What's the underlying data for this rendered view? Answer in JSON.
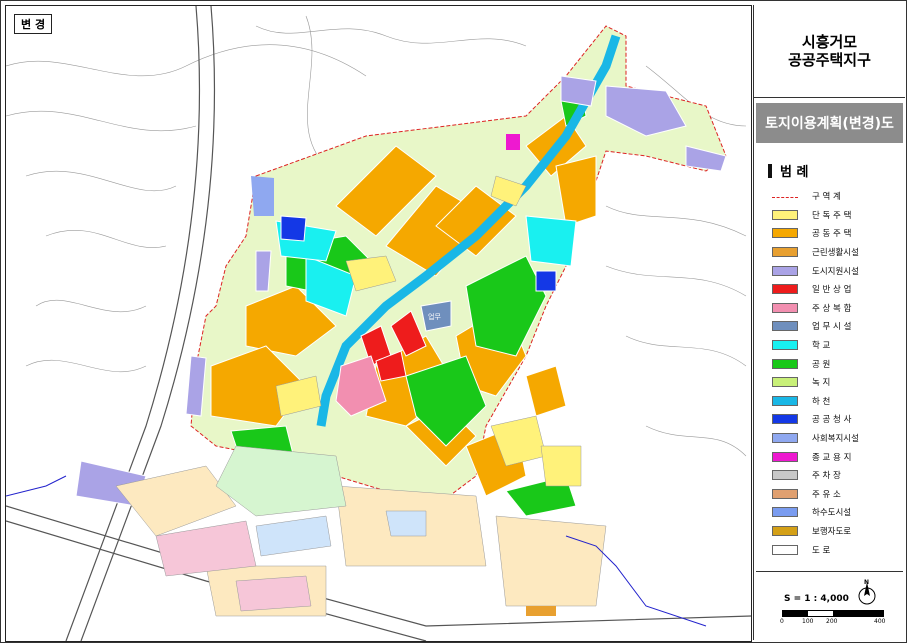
{
  "map_label": "변 경",
  "title": {
    "line1": "시흥거모",
    "line2": "공공주택지구"
  },
  "subtitle": "토지이용계획(변경)도",
  "legend": {
    "heading": "범    례",
    "items": [
      {
        "label": "구  역  계",
        "color": "#ffffff",
        "kind": "boundary"
      },
      {
        "label": "단 독 주 택",
        "color": "#fff27a"
      },
      {
        "label": "공 동 주 택",
        "color": "#f5a800"
      },
      {
        "label": "근린생활시설",
        "color": "#e8a030"
      },
      {
        "label": "도시지원시설",
        "color": "#aaa3e6"
      },
      {
        "label": "일 반 상 업",
        "color": "#ee1c1c"
      },
      {
        "label": "주 상 복 합",
        "color": "#f28fb0"
      },
      {
        "label": "업 무 시 설",
        "color": "#6f8fbd"
      },
      {
        "label": "학        교",
        "color": "#19f0f0"
      },
      {
        "label": "공        원",
        "color": "#19c819"
      },
      {
        "label": "녹        지",
        "color": "#c8f078"
      },
      {
        "label": "하        천",
        "color": "#19b7e6"
      },
      {
        "label": "공 공 청 사",
        "color": "#1438e6"
      },
      {
        "label": "사회복지시설",
        "color": "#8fa8f0"
      },
      {
        "label": "종 교 용 지",
        "color": "#ee19d0"
      },
      {
        "label": "주  차  장",
        "color": "#c8c8c8"
      },
      {
        "label": "주  유  소",
        "color": "#e0a070"
      },
      {
        "label": "하수도시설",
        "color": "#7a9cf0"
      },
      {
        "label": "보행자도로",
        "color": "#d4a017"
      },
      {
        "label": "도        로",
        "color": "#ffffff"
      }
    ]
  },
  "scale": {
    "text": "S = 1 : 4,000",
    "ticks": [
      "0",
      "100",
      "200",
      "400"
    ]
  },
  "labels": {
    "office": "업무"
  }
}
